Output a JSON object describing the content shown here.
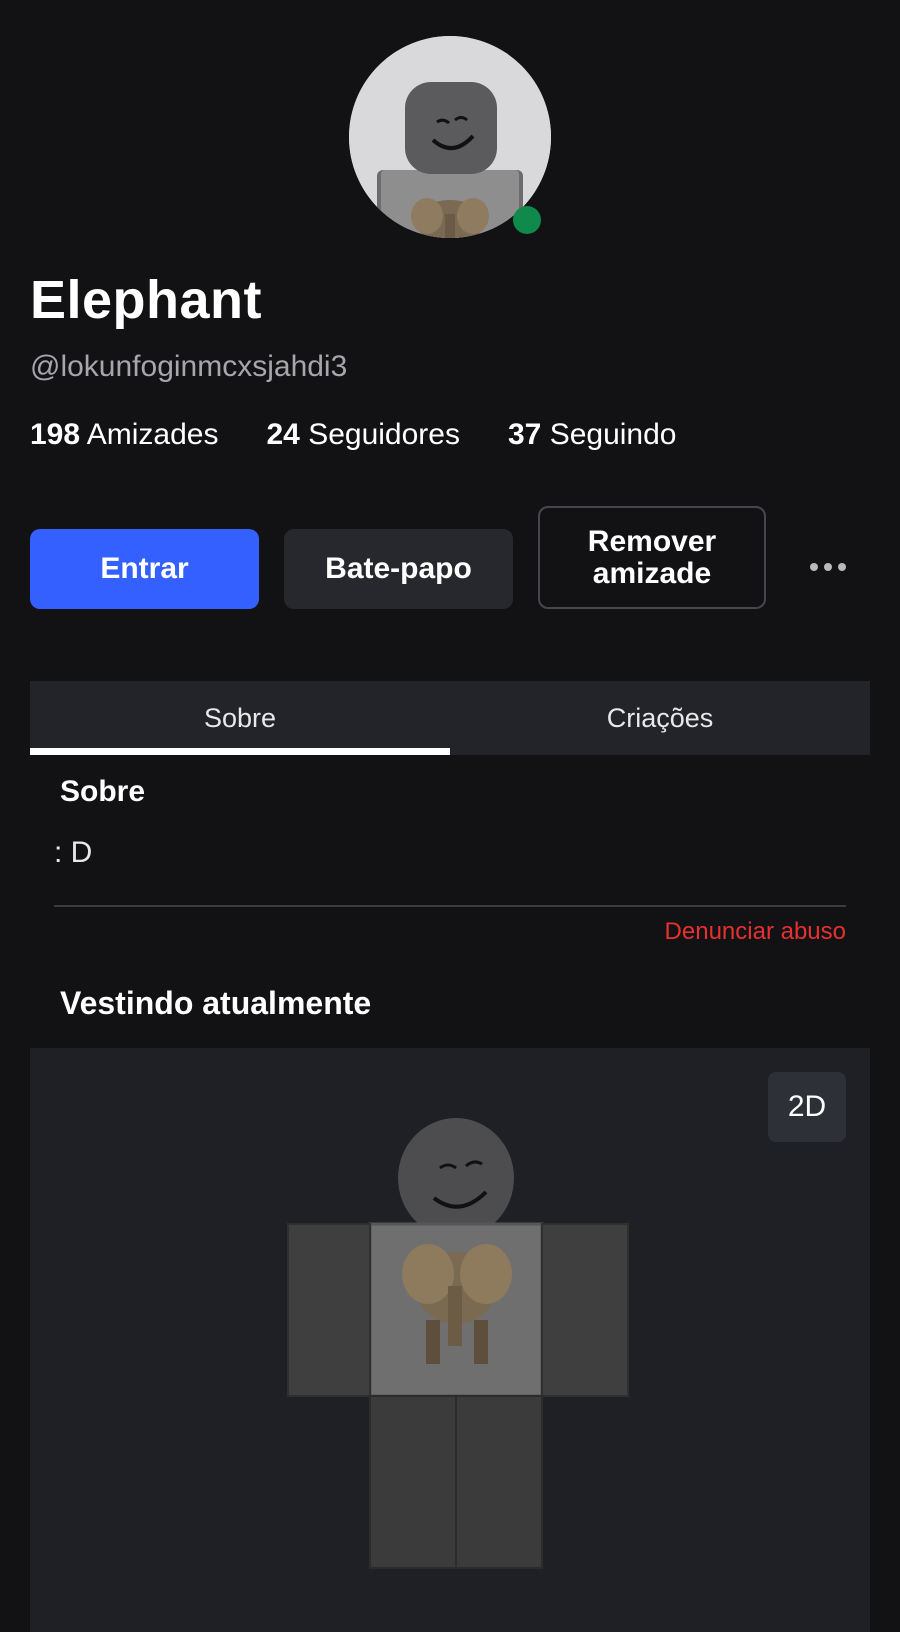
{
  "profile": {
    "display_name": "Elephant",
    "username": "@lokunfoginmcxsjahdi3",
    "online_status_color": "#0f8a4b"
  },
  "stats": [
    {
      "count": "198",
      "label": "Amizades"
    },
    {
      "count": "24",
      "label": "Seguidores"
    },
    {
      "count": "37",
      "label": "Seguindo"
    }
  ],
  "actions": {
    "join_label": "Entrar",
    "chat_label": "Bate-papo",
    "remove_label": "Remover amizade",
    "more_icon": "more-horizontal-icon"
  },
  "tabs": [
    {
      "label": "Sobre",
      "active": true
    },
    {
      "label": "Criações",
      "active": false
    }
  ],
  "about": {
    "title": "Sobre",
    "text": ": D",
    "report_label": "Denunciar abuso"
  },
  "wearing": {
    "title": "Vestindo atualmente",
    "view_toggle_label": "2D"
  },
  "colors": {
    "background": "#121215",
    "primary_button": "#3360ff",
    "secondary_button": "#27282d",
    "report_link": "#e5312f"
  }
}
